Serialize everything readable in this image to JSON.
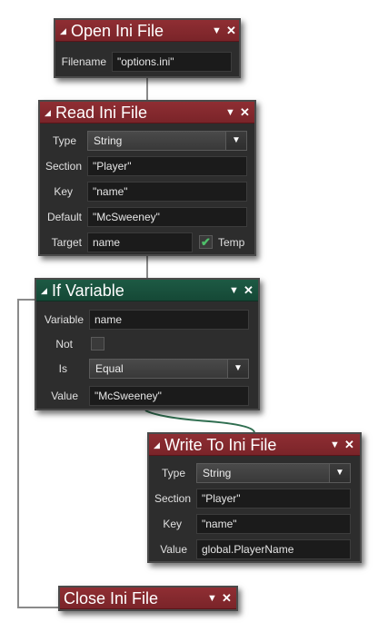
{
  "icons": {
    "collapse": "collapse-triangle-icon",
    "dropdown": "dropdown-arrow-icon",
    "close": "close-icon",
    "checked": "checkmark-icon"
  },
  "glyphs": {
    "collapse": "◢",
    "dropdown": "▼",
    "close": "✕",
    "check": "✔",
    "select_arrow": "▼"
  },
  "colors": {
    "action_header": "#8f2e33",
    "condition_header": "#1d5a44",
    "block_body": "#2d2d2d"
  },
  "open_ini": {
    "title": "Open Ini File",
    "filename_label": "Filename",
    "filename_value": "\"options.ini\""
  },
  "read_ini": {
    "title": "Read Ini File",
    "type_label": "Type",
    "type_value": "String",
    "section_label": "Section",
    "section_value": "\"Player\"",
    "key_label": "Key",
    "key_value": "\"name\"",
    "default_label": "Default",
    "default_value": "\"McSweeney\"",
    "target_label": "Target",
    "target_value": "name",
    "temp_label": "Temp",
    "temp_checked": true
  },
  "if_variable": {
    "title": "If Variable",
    "variable_label": "Variable",
    "variable_value": "name",
    "not_label": "Not",
    "not_checked": false,
    "is_label": "Is",
    "is_value": "Equal",
    "value_label": "Value",
    "value_value": "\"McSweeney\""
  },
  "write_ini": {
    "title": "Write To Ini File",
    "type_label": "Type",
    "type_value": "String",
    "section_label": "Section",
    "section_value": "\"Player\"",
    "key_label": "Key",
    "key_value": "\"name\"",
    "value_label": "Value",
    "value_value": "global.PlayerName"
  },
  "close_ini": {
    "title": "Close Ini File"
  }
}
